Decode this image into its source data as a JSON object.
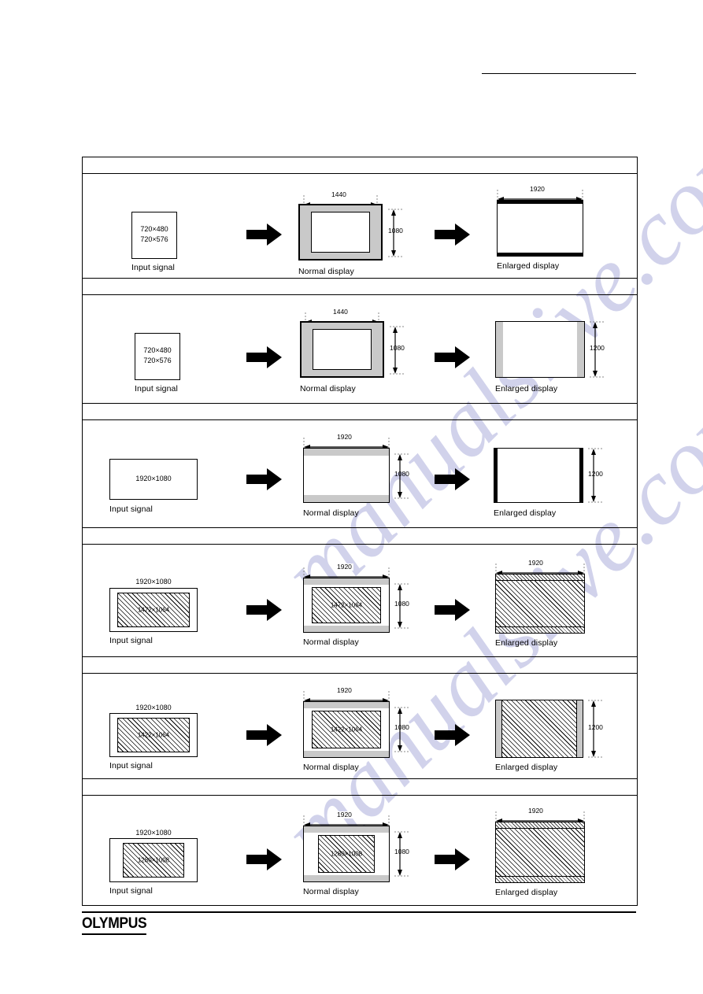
{
  "page": {
    "brand": "OLYMPUS",
    "watermark": "manualslive.com"
  },
  "labels": {
    "input_signal": "Input signal",
    "normal_display": "Normal display",
    "enlarged_display": "Enlarged display"
  },
  "rows": [
    {
      "id": "row-1",
      "input": {
        "lines": [
          "720×480",
          "720×576"
        ],
        "caption": "Input signal"
      },
      "normal": {
        "width_dim": "1440",
        "height_dim": "1080",
        "caption": "Normal display"
      },
      "enlarged": {
        "width_dim": "1920",
        "height_dim": "",
        "caption": "Enlarged display"
      }
    },
    {
      "id": "row-2",
      "input": {
        "lines": [
          "720×480",
          "720×576"
        ],
        "caption": "Input signal"
      },
      "normal": {
        "width_dim": "1440",
        "height_dim": "1080",
        "caption": "Normal display"
      },
      "enlarged": {
        "width_dim": "",
        "height_dim": "1200",
        "caption": "Enlarged display"
      }
    },
    {
      "id": "row-3",
      "input": {
        "lines": [
          "1920×1080"
        ],
        "caption": "Input signal"
      },
      "normal": {
        "width_dim": "1920",
        "height_dim": "1080",
        "caption": "Normal display"
      },
      "enlarged": {
        "width_dim": "",
        "height_dim": "1200",
        "caption": "Enlarged display"
      }
    },
    {
      "id": "row-4",
      "input": {
        "outer_label": "1920×1080",
        "inner_label": "1472×1064",
        "caption": "Input signal"
      },
      "normal": {
        "width_dim": "1920",
        "height_dim": "1080",
        "inner_label": "1472×1064",
        "caption": "Normal display"
      },
      "enlarged": {
        "width_dim": "1920",
        "height_dim": "",
        "caption": "Enlarged display"
      }
    },
    {
      "id": "row-5",
      "input": {
        "outer_label": "1920×1080",
        "inner_label": "1422×1064",
        "caption": "Input signal"
      },
      "normal": {
        "width_dim": "1920",
        "height_dim": "1080",
        "inner_label": "1422×1064",
        "caption": "Normal display"
      },
      "enlarged": {
        "width_dim": "",
        "height_dim": "1200",
        "caption": "Enlarged display"
      }
    },
    {
      "id": "row-6",
      "input": {
        "outer_label": "1920×1080",
        "inner_label": "1280×1008",
        "caption": "Input signal"
      },
      "normal": {
        "width_dim": "1920",
        "height_dim": "1080",
        "inner_label": "1280×1008",
        "caption": "Normal display"
      },
      "enlarged": {
        "width_dim": "1920",
        "height_dim": "",
        "caption": "Enlarged display"
      }
    }
  ]
}
